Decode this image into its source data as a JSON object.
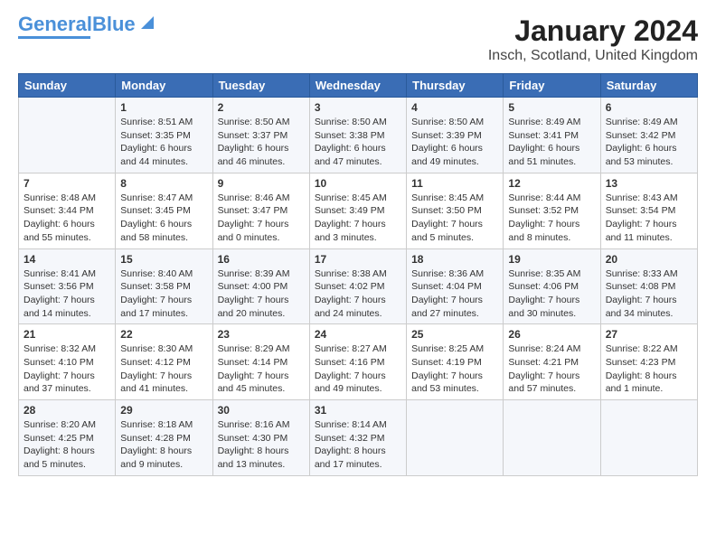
{
  "logo": {
    "part1": "General",
    "part2": "Blue"
  },
  "title": "January 2024",
  "location": "Insch, Scotland, United Kingdom",
  "days_of_week": [
    "Sunday",
    "Monday",
    "Tuesday",
    "Wednesday",
    "Thursday",
    "Friday",
    "Saturday"
  ],
  "weeks": [
    [
      {
        "day": "",
        "info": ""
      },
      {
        "day": "1",
        "info": "Sunrise: 8:51 AM\nSunset: 3:35 PM\nDaylight: 6 hours\nand 44 minutes."
      },
      {
        "day": "2",
        "info": "Sunrise: 8:50 AM\nSunset: 3:37 PM\nDaylight: 6 hours\nand 46 minutes."
      },
      {
        "day": "3",
        "info": "Sunrise: 8:50 AM\nSunset: 3:38 PM\nDaylight: 6 hours\nand 47 minutes."
      },
      {
        "day": "4",
        "info": "Sunrise: 8:50 AM\nSunset: 3:39 PM\nDaylight: 6 hours\nand 49 minutes."
      },
      {
        "day": "5",
        "info": "Sunrise: 8:49 AM\nSunset: 3:41 PM\nDaylight: 6 hours\nand 51 minutes."
      },
      {
        "day": "6",
        "info": "Sunrise: 8:49 AM\nSunset: 3:42 PM\nDaylight: 6 hours\nand 53 minutes."
      }
    ],
    [
      {
        "day": "7",
        "info": "Sunrise: 8:48 AM\nSunset: 3:44 PM\nDaylight: 6 hours\nand 55 minutes."
      },
      {
        "day": "8",
        "info": "Sunrise: 8:47 AM\nSunset: 3:45 PM\nDaylight: 6 hours\nand 58 minutes."
      },
      {
        "day": "9",
        "info": "Sunrise: 8:46 AM\nSunset: 3:47 PM\nDaylight: 7 hours\nand 0 minutes."
      },
      {
        "day": "10",
        "info": "Sunrise: 8:45 AM\nSunset: 3:49 PM\nDaylight: 7 hours\nand 3 minutes."
      },
      {
        "day": "11",
        "info": "Sunrise: 8:45 AM\nSunset: 3:50 PM\nDaylight: 7 hours\nand 5 minutes."
      },
      {
        "day": "12",
        "info": "Sunrise: 8:44 AM\nSunset: 3:52 PM\nDaylight: 7 hours\nand 8 minutes."
      },
      {
        "day": "13",
        "info": "Sunrise: 8:43 AM\nSunset: 3:54 PM\nDaylight: 7 hours\nand 11 minutes."
      }
    ],
    [
      {
        "day": "14",
        "info": "Sunrise: 8:41 AM\nSunset: 3:56 PM\nDaylight: 7 hours\nand 14 minutes."
      },
      {
        "day": "15",
        "info": "Sunrise: 8:40 AM\nSunset: 3:58 PM\nDaylight: 7 hours\nand 17 minutes."
      },
      {
        "day": "16",
        "info": "Sunrise: 8:39 AM\nSunset: 4:00 PM\nDaylight: 7 hours\nand 20 minutes."
      },
      {
        "day": "17",
        "info": "Sunrise: 8:38 AM\nSunset: 4:02 PM\nDaylight: 7 hours\nand 24 minutes."
      },
      {
        "day": "18",
        "info": "Sunrise: 8:36 AM\nSunset: 4:04 PM\nDaylight: 7 hours\nand 27 minutes."
      },
      {
        "day": "19",
        "info": "Sunrise: 8:35 AM\nSunset: 4:06 PM\nDaylight: 7 hours\nand 30 minutes."
      },
      {
        "day": "20",
        "info": "Sunrise: 8:33 AM\nSunset: 4:08 PM\nDaylight: 7 hours\nand 34 minutes."
      }
    ],
    [
      {
        "day": "21",
        "info": "Sunrise: 8:32 AM\nSunset: 4:10 PM\nDaylight: 7 hours\nand 37 minutes."
      },
      {
        "day": "22",
        "info": "Sunrise: 8:30 AM\nSunset: 4:12 PM\nDaylight: 7 hours\nand 41 minutes."
      },
      {
        "day": "23",
        "info": "Sunrise: 8:29 AM\nSunset: 4:14 PM\nDaylight: 7 hours\nand 45 minutes."
      },
      {
        "day": "24",
        "info": "Sunrise: 8:27 AM\nSunset: 4:16 PM\nDaylight: 7 hours\nand 49 minutes."
      },
      {
        "day": "25",
        "info": "Sunrise: 8:25 AM\nSunset: 4:19 PM\nDaylight: 7 hours\nand 53 minutes."
      },
      {
        "day": "26",
        "info": "Sunrise: 8:24 AM\nSunset: 4:21 PM\nDaylight: 7 hours\nand 57 minutes."
      },
      {
        "day": "27",
        "info": "Sunrise: 8:22 AM\nSunset: 4:23 PM\nDaylight: 8 hours\nand 1 minute."
      }
    ],
    [
      {
        "day": "28",
        "info": "Sunrise: 8:20 AM\nSunset: 4:25 PM\nDaylight: 8 hours\nand 5 minutes."
      },
      {
        "day": "29",
        "info": "Sunrise: 8:18 AM\nSunset: 4:28 PM\nDaylight: 8 hours\nand 9 minutes."
      },
      {
        "day": "30",
        "info": "Sunrise: 8:16 AM\nSunset: 4:30 PM\nDaylight: 8 hours\nand 13 minutes."
      },
      {
        "day": "31",
        "info": "Sunrise: 8:14 AM\nSunset: 4:32 PM\nDaylight: 8 hours\nand 17 minutes."
      },
      {
        "day": "",
        "info": ""
      },
      {
        "day": "",
        "info": ""
      },
      {
        "day": "",
        "info": ""
      }
    ]
  ]
}
